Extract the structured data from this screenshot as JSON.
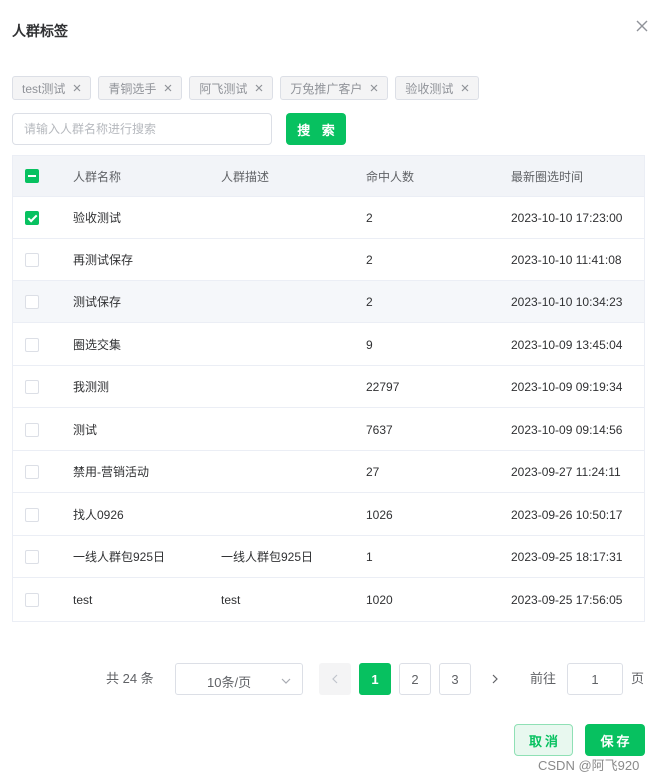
{
  "dialog": {
    "title": "人群标签",
    "close_icon": "close-icon"
  },
  "tags": [
    {
      "label": "test测试"
    },
    {
      "label": "青铜选手"
    },
    {
      "label": "阿飞测试"
    },
    {
      "label": "万兔推广客户"
    },
    {
      "label": "验收测试"
    }
  ],
  "search": {
    "placeholder": "请输入人群名称进行搜索",
    "value": "",
    "button_label": "搜 索"
  },
  "table": {
    "select_all_state": "indeterminate",
    "columns": [
      "人群名称",
      "人群描述",
      "命中人数",
      "最新圈选时间"
    ],
    "rows": [
      {
        "checked": true,
        "name": "验收测试",
        "desc": "",
        "hits": "2",
        "time": "2023-10-10 17:23:00"
      },
      {
        "checked": false,
        "name": "再测试保存",
        "desc": "",
        "hits": "2",
        "time": "2023-10-10 11:41:08"
      },
      {
        "checked": false,
        "name": "测试保存",
        "desc": "",
        "hits": "2",
        "time": "2023-10-10 10:34:23"
      },
      {
        "checked": false,
        "name": "圈选交集",
        "desc": "",
        "hits": "9",
        "time": "2023-10-09 13:45:04"
      },
      {
        "checked": false,
        "name": "我测测",
        "desc": "",
        "hits": "22797",
        "time": "2023-10-09 09:19:34"
      },
      {
        "checked": false,
        "name": "测试",
        "desc": "",
        "hits": "7637",
        "time": "2023-10-09 09:14:56"
      },
      {
        "checked": false,
        "name": "禁用-营销活动",
        "desc": "",
        "hits": "27",
        "time": "2023-09-27 11:24:11"
      },
      {
        "checked": false,
        "name": "找人0926",
        "desc": "",
        "hits": "1026",
        "time": "2023-09-26 10:50:17"
      },
      {
        "checked": false,
        "name": "一线人群包925日",
        "desc": "一线人群包925日",
        "hits": "1",
        "time": "2023-09-25 18:17:31"
      },
      {
        "checked": false,
        "name": "test",
        "desc": "test",
        "hits": "1020",
        "time": "2023-09-25 17:56:05"
      }
    ]
  },
  "pagination": {
    "total_text": "共 24 条",
    "page_size": "10条/页",
    "pages": [
      "1",
      "2",
      "3"
    ],
    "current_page": "1",
    "jump_label": "前往",
    "jump_value": "1",
    "jump_unit": "页"
  },
  "footer": {
    "cancel_label": "取消",
    "save_label": "保存"
  },
  "watermark": "CSDN @阿飞920",
  "colors": {
    "accent": "#07c160",
    "header_bg": "#f2f4f8"
  }
}
